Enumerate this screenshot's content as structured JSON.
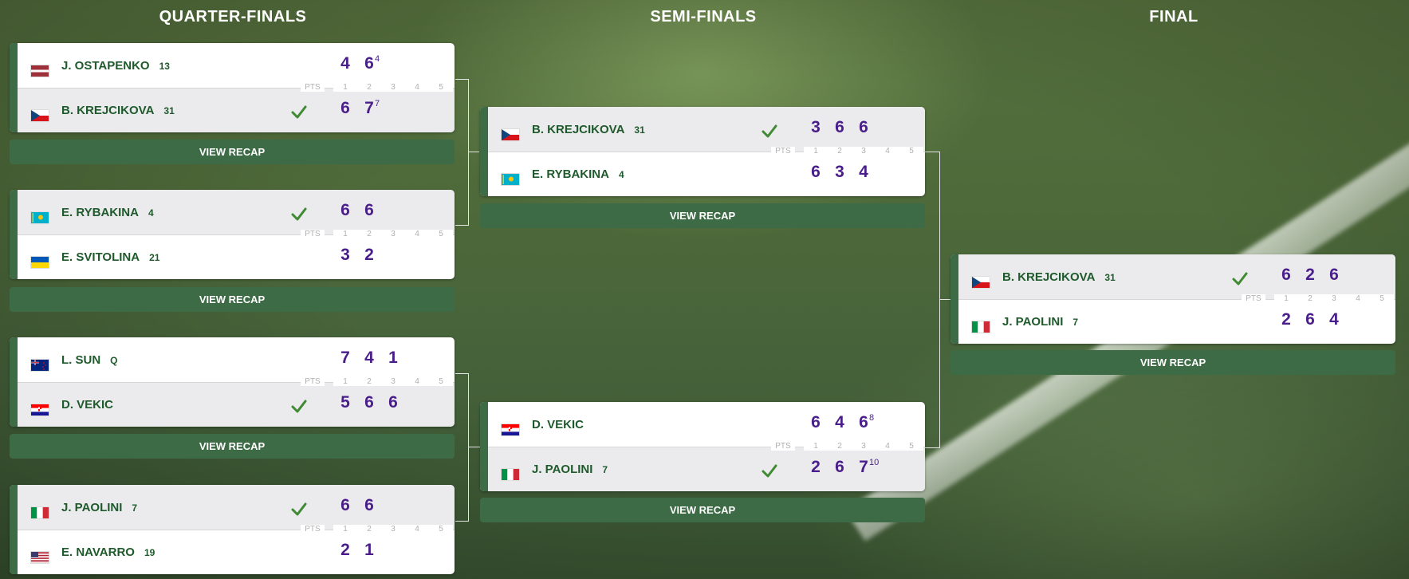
{
  "rounds": [
    "QUARTER-FINALS",
    "SEMI-FINALS",
    "FINAL"
  ],
  "pts_label": "PTS",
  "set_labels": [
    "1",
    "2",
    "3",
    "4",
    "5"
  ],
  "recap_label": "VIEW RECAP",
  "colors": {
    "accent_green": "#3d6b45",
    "name_green": "#1f5a2c",
    "score_purple": "#4a1e8a"
  },
  "matches": [
    {
      "round": "QUARTER-FINALS",
      "players": [
        {
          "name": "J. OSTAPENKO",
          "seed": "13",
          "flag": "latvia-flag",
          "winner": false,
          "scores": [
            "4",
            "6"
          ],
          "tiebreaks": [
            "",
            "4"
          ]
        },
        {
          "name": "B. KREJCIKOVA",
          "seed": "31",
          "flag": "czech-flag",
          "winner": true,
          "scores": [
            "6",
            "7"
          ],
          "tiebreaks": [
            "",
            "7"
          ]
        }
      ]
    },
    {
      "round": "QUARTER-FINALS",
      "players": [
        {
          "name": "E. RYBAKINA",
          "seed": "4",
          "flag": "kazakhstan-flag",
          "winner": true,
          "scores": [
            "6",
            "6"
          ],
          "tiebreaks": [
            "",
            ""
          ]
        },
        {
          "name": "E. SVITOLINA",
          "seed": "21",
          "flag": "ukraine-flag",
          "winner": false,
          "scores": [
            "3",
            "2"
          ],
          "tiebreaks": [
            "",
            ""
          ]
        }
      ]
    },
    {
      "round": "QUARTER-FINALS",
      "players": [
        {
          "name": "L. SUN",
          "seed": "Q",
          "flag": "new-zealand-flag",
          "winner": false,
          "scores": [
            "7",
            "4",
            "1"
          ],
          "tiebreaks": [
            "",
            "",
            ""
          ]
        },
        {
          "name": "D. VEKIC",
          "seed": "",
          "flag": "croatia-flag",
          "winner": true,
          "scores": [
            "5",
            "6",
            "6"
          ],
          "tiebreaks": [
            "",
            "",
            ""
          ]
        }
      ]
    },
    {
      "round": "QUARTER-FINALS",
      "players": [
        {
          "name": "J. PAOLINI",
          "seed": "7",
          "flag": "italy-flag",
          "winner": true,
          "scores": [
            "6",
            "6"
          ],
          "tiebreaks": [
            "",
            ""
          ]
        },
        {
          "name": "E. NAVARRO",
          "seed": "19",
          "flag": "usa-flag",
          "winner": false,
          "scores": [
            "2",
            "1"
          ],
          "tiebreaks": [
            "",
            ""
          ]
        }
      ]
    },
    {
      "round": "SEMI-FINALS",
      "players": [
        {
          "name": "B. KREJCIKOVA",
          "seed": "31",
          "flag": "czech-flag",
          "winner": true,
          "scores": [
            "3",
            "6",
            "6"
          ],
          "tiebreaks": [
            "",
            "",
            ""
          ]
        },
        {
          "name": "E. RYBAKINA",
          "seed": "4",
          "flag": "kazakhstan-flag",
          "winner": false,
          "scores": [
            "6",
            "3",
            "4"
          ],
          "tiebreaks": [
            "",
            "",
            ""
          ]
        }
      ]
    },
    {
      "round": "SEMI-FINALS",
      "players": [
        {
          "name": "D. VEKIC",
          "seed": "",
          "flag": "croatia-flag",
          "winner": false,
          "scores": [
            "6",
            "4",
            "6"
          ],
          "tiebreaks": [
            "",
            "",
            "8"
          ]
        },
        {
          "name": "J. PAOLINI",
          "seed": "7",
          "flag": "italy-flag",
          "winner": true,
          "scores": [
            "2",
            "6",
            "7"
          ],
          "tiebreaks": [
            "",
            "",
            "10"
          ]
        }
      ]
    },
    {
      "round": "FINAL",
      "players": [
        {
          "name": "B. KREJCIKOVA",
          "seed": "31",
          "flag": "czech-flag",
          "winner": true,
          "scores": [
            "6",
            "2",
            "6"
          ],
          "tiebreaks": [
            "",
            "",
            ""
          ]
        },
        {
          "name": "J. PAOLINI",
          "seed": "7",
          "flag": "italy-flag",
          "winner": false,
          "scores": [
            "2",
            "6",
            "4"
          ],
          "tiebreaks": [
            "",
            "",
            ""
          ]
        }
      ]
    }
  ]
}
